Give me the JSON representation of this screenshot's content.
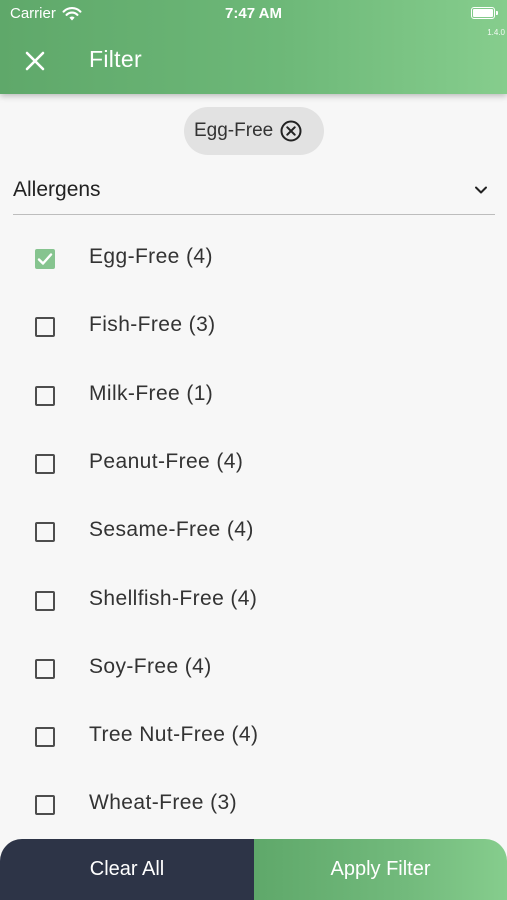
{
  "status_bar": {
    "carrier": "Carrier",
    "time": "7:47 AM",
    "version": "1.4.0"
  },
  "header": {
    "title": "Filter"
  },
  "selected_chip": {
    "label": "Egg-Free"
  },
  "section": {
    "title": "Allergens",
    "expanded": true
  },
  "options": [
    {
      "label": "Egg-Free (4)",
      "checked": true
    },
    {
      "label": "Fish-Free (3)",
      "checked": false
    },
    {
      "label": "Milk-Free (1)",
      "checked": false
    },
    {
      "label": "Peanut-Free (4)",
      "checked": false
    },
    {
      "label": "Sesame-Free (4)",
      "checked": false
    },
    {
      "label": "Shellfish-Free (4)",
      "checked": false
    },
    {
      "label": "Soy-Free (4)",
      "checked": false
    },
    {
      "label": "Tree Nut-Free (4)",
      "checked": false
    },
    {
      "label": "Wheat-Free (3)",
      "checked": false
    }
  ],
  "footer": {
    "clear_label": "Clear All",
    "apply_label": "Apply Filter"
  },
  "colors": {
    "primary_green": "#6db878",
    "dark_navy": "#2d3447",
    "check_green": "#86c48f"
  }
}
